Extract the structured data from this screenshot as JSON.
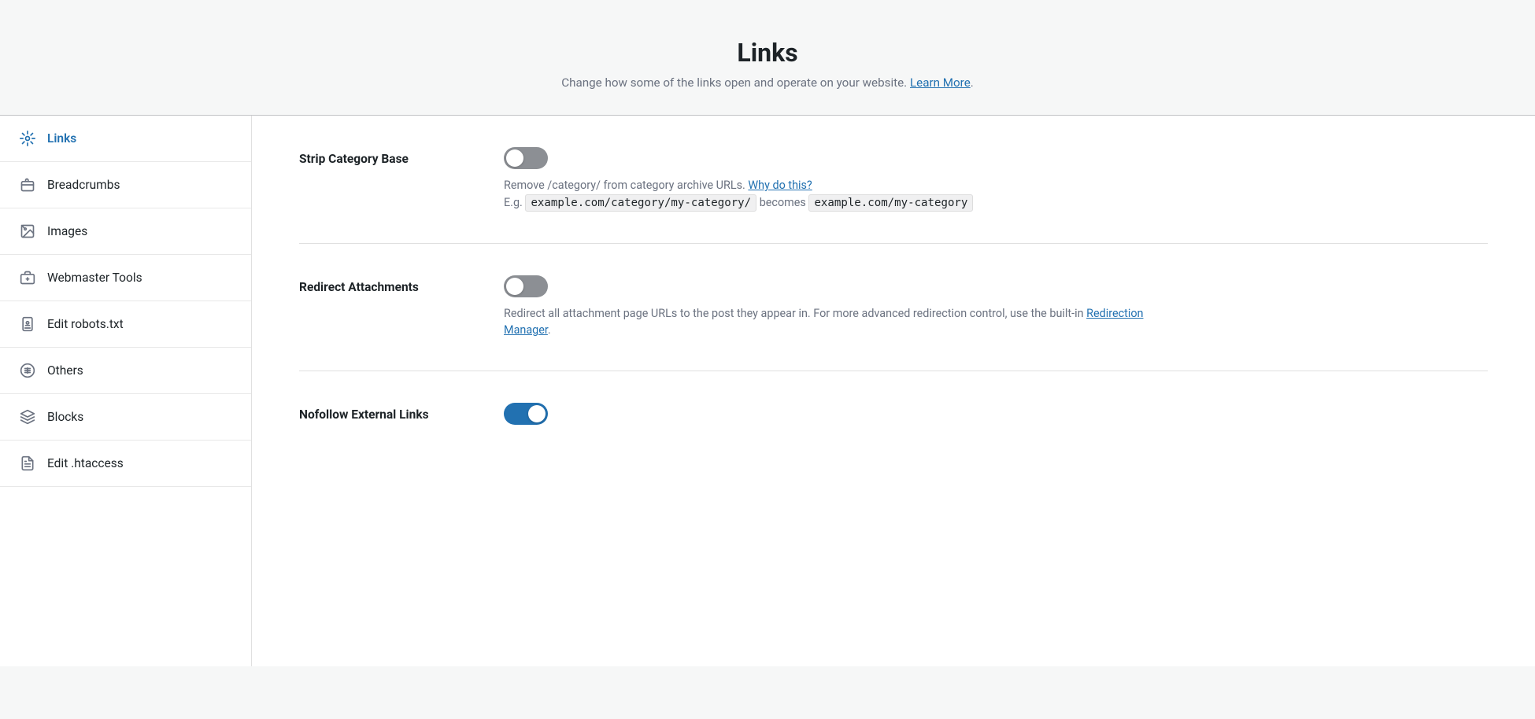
{
  "page": {
    "title": "Links",
    "subtitle": "Change how some of the links open and operate on your website.",
    "learn_more_label": "Learn More"
  },
  "sidebar": {
    "items": [
      {
        "id": "links",
        "label": "Links",
        "active": true,
        "icon": "links-icon"
      },
      {
        "id": "breadcrumbs",
        "label": "Breadcrumbs",
        "active": false,
        "icon": "breadcrumbs-icon"
      },
      {
        "id": "images",
        "label": "Images",
        "active": false,
        "icon": "images-icon"
      },
      {
        "id": "webmaster-tools",
        "label": "Webmaster Tools",
        "active": false,
        "icon": "webmaster-icon"
      },
      {
        "id": "edit-robots",
        "label": "Edit robots.txt",
        "active": false,
        "icon": "robots-icon"
      },
      {
        "id": "others",
        "label": "Others",
        "active": false,
        "icon": "others-icon"
      },
      {
        "id": "blocks",
        "label": "Blocks",
        "active": false,
        "icon": "blocks-icon"
      },
      {
        "id": "edit-htaccess",
        "label": "Edit .htaccess",
        "active": false,
        "icon": "htaccess-icon"
      }
    ]
  },
  "settings": [
    {
      "id": "strip-category-base",
      "label": "Strip Category Base",
      "toggle_state": "off",
      "description_before": "Remove /category/ from category archive URLs.",
      "link_text": "Why do this?",
      "example_before": "example.com/category/my-category/",
      "example_connector": "becomes",
      "example_after": "example.com/my-category",
      "prefix": "E.g.",
      "has_example": true
    },
    {
      "id": "redirect-attachments",
      "label": "Redirect Attachments",
      "toggle_state": "off",
      "description_before": "Redirect all attachment page URLs to the post they appear in. For more advanced redirection control, use the built-in",
      "link_text": "Redirection Manager",
      "description_after": ".",
      "has_example": false
    },
    {
      "id": "nofollow-external-links",
      "label": "Nofollow External Links",
      "toggle_state": "on",
      "description_before": "",
      "link_text": "",
      "has_example": false
    }
  ],
  "colors": {
    "accent": "#2271b1",
    "toggle_off": "#8c8f94",
    "toggle_on": "#2271b1"
  }
}
